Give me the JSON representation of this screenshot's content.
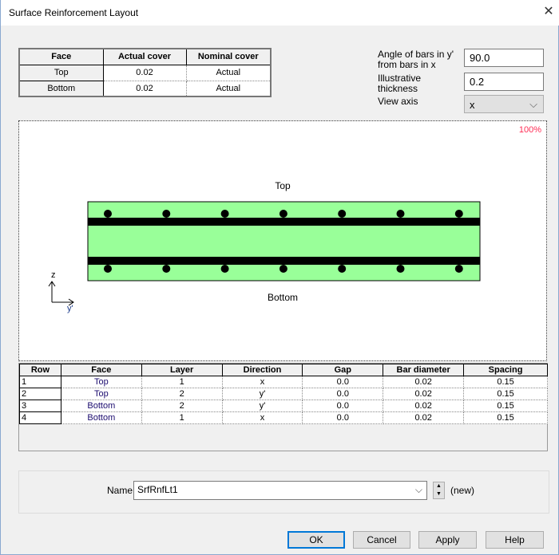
{
  "window": {
    "title": "Surface Reinforcement Layout",
    "close": "✕"
  },
  "cover_table": {
    "headers": [
      "Face",
      "Actual cover",
      "Nominal cover"
    ],
    "rows": [
      [
        "Top",
        "0.02",
        "Actual"
      ],
      [
        "Bottom",
        "0.02",
        "Actual"
      ]
    ]
  },
  "settings": {
    "angle_label": "Angle of bars in y' from bars in x",
    "angle_value": "90.0",
    "thickness_label": "Illustrative thickness",
    "thickness_value": "0.2",
    "view_axis_label": "View axis",
    "view_axis_value": "x"
  },
  "view": {
    "zoom": "100%",
    "top_label": "Top",
    "bottom_label": "Bottom",
    "axis_z": "z",
    "axis_y": "y'",
    "colors": {
      "section": "#99ff99",
      "bars": "#000000"
    },
    "bars_per_layer": 7
  },
  "layers_table": {
    "headers": [
      "Row",
      "Face",
      "Layer",
      "Direction",
      "Gap",
      "Bar diameter",
      "Spacing"
    ],
    "rows": [
      [
        "1",
        "Top",
        "1",
        "x",
        "0.0",
        "0.02",
        "0.15"
      ],
      [
        "2",
        "Top",
        "2",
        "y'",
        "0.0",
        "0.02",
        "0.15"
      ],
      [
        "3",
        "Bottom",
        "2",
        "y'",
        "0.0",
        "0.02",
        "0.15"
      ],
      [
        "4",
        "Bottom",
        "1",
        "x",
        "0.0",
        "0.02",
        "0.15"
      ]
    ]
  },
  "name": {
    "label": "Name",
    "value": "SrfRnfLt1",
    "status": "(new)"
  },
  "buttons": {
    "ok": "OK",
    "cancel": "Cancel",
    "apply": "Apply",
    "help": "Help"
  }
}
